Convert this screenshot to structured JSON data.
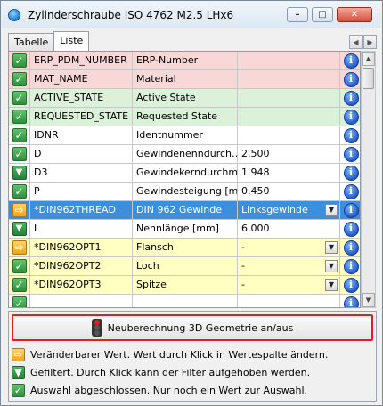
{
  "window": {
    "title": "Zylinderschraube ISO 4762 M2.5 LHx6",
    "buttons": {
      "minimize": "–",
      "maximize": "□",
      "close": "✕"
    }
  },
  "tabs": [
    {
      "label": "Tabelle",
      "active": false
    },
    {
      "label": "Liste",
      "active": true
    }
  ],
  "rows": [
    {
      "status": "check",
      "name": "ERP_PDM_NUMBER",
      "desc": "ERP-Number",
      "value": "",
      "color": "pink"
    },
    {
      "status": "check",
      "name": "MAT_NAME",
      "desc": "Material",
      "value": "",
      "color": "pink"
    },
    {
      "status": "check",
      "name": "ACTIVE_STATE",
      "desc": "Active State",
      "value": "",
      "color": "green"
    },
    {
      "status": "check",
      "name": "REQUESTED_STATE",
      "desc": "Requested State",
      "value": "",
      "color": "green"
    },
    {
      "status": "check",
      "name": "IDNR",
      "desc": "Identnummer",
      "value": "",
      "color": "white"
    },
    {
      "status": "check",
      "name": "D",
      "desc": "Gewindenenndurch…",
      "value": "2.500",
      "color": "white"
    },
    {
      "status": "filter",
      "name": "D3",
      "desc": "Gewindekerndurchm…",
      "value": "1.948",
      "color": "white"
    },
    {
      "status": "check",
      "name": "P",
      "desc": "Gewindesteigung [mm]",
      "value": "0.450",
      "color": "white"
    },
    {
      "status": "arrow",
      "name": "*DIN962THREAD",
      "desc": "DIN 962 Gewinde",
      "value": "Linksgewinde",
      "color": "selected",
      "dropdown": true
    },
    {
      "status": "filter",
      "name": "L",
      "desc": "Nennlänge [mm]",
      "value": "6.000",
      "color": "white"
    },
    {
      "status": "arrow",
      "name": "*DIN962OPT1",
      "desc": "Flansch",
      "value": "-",
      "color": "yellow",
      "dropdown": true
    },
    {
      "status": "check",
      "name": "*DIN962OPT2",
      "desc": "Loch",
      "value": "-",
      "color": "yellow",
      "dropdown": true
    },
    {
      "status": "check",
      "name": "*DIN962OPT3",
      "desc": "Spitze",
      "value": "-",
      "color": "yellow",
      "dropdown": true
    },
    {
      "status": "check",
      "name": "",
      "desc": "",
      "value": "",
      "color": "white"
    }
  ],
  "recalc_button": {
    "label": "Neuberechnung 3D Geometrie an/aus"
  },
  "legend": [
    {
      "icon": "arrow",
      "text": "Veränderbarer Wert. Wert durch Klick in Wertespalte ändern."
    },
    {
      "icon": "filter",
      "text": "Gefiltert. Durch Klick kann der Filter aufgehoben werden."
    },
    {
      "icon": "check",
      "text": "Auswahl abgeschlossen. Nur noch ein Wert zur Auswahl."
    }
  ],
  "icons": {
    "info": "i",
    "check": "✓",
    "filter": "▼",
    "arrow": "⇨",
    "dropdown": "▼"
  }
}
